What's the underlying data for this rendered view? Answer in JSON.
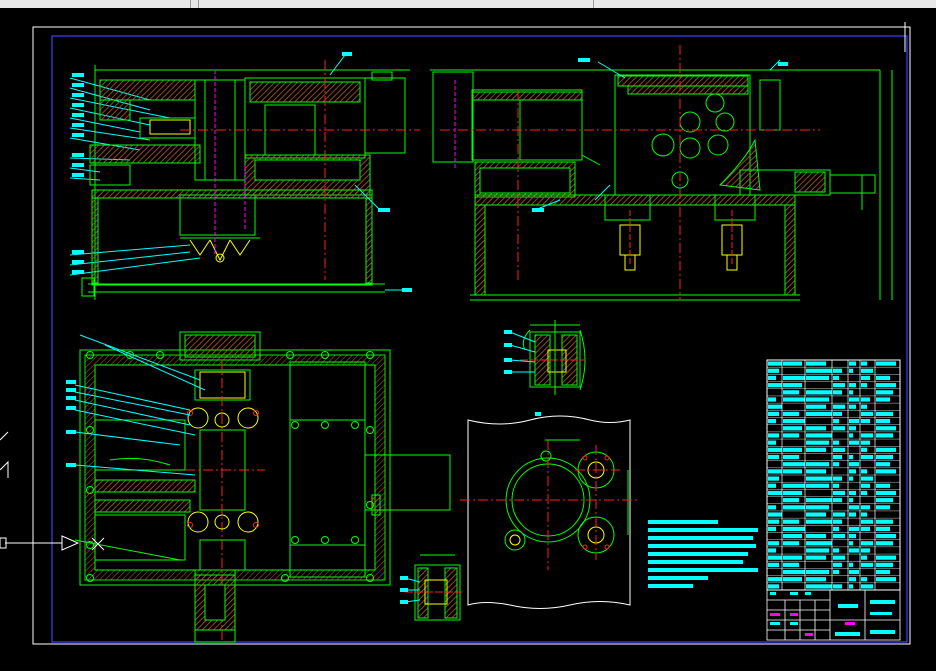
{
  "app": {
    "title": ""
  },
  "colors": {
    "background": "#000000",
    "frame": "#3c3cff",
    "green": "#00ff00",
    "cyan": "#00ffff",
    "yellow": "#ffff00",
    "red": "#ff2020",
    "magenta": "#ff00ff",
    "hatch": "#b05a28",
    "white": "#ffffff"
  },
  "views": [
    {
      "name": "front-elevation-view"
    },
    {
      "name": "side-elevation-view"
    },
    {
      "name": "plan-view"
    },
    {
      "name": "detail-section-upper"
    },
    {
      "name": "detail-flange-view"
    },
    {
      "name": "detail-section-lower"
    }
  ],
  "icons": [
    "selection-arrow-icon",
    "ucs-icon",
    "crosshair-cursor-icon"
  ],
  "notes_block": {
    "line_count": 9
  },
  "parts_list": {
    "row_count": 32,
    "column_count": 7
  },
  "title_block": {
    "present": true
  }
}
